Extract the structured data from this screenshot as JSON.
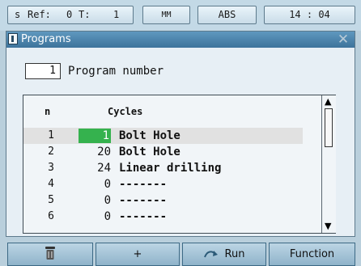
{
  "status_bar": {
    "mode": "s",
    "ref_label": "Ref:",
    "ref_value": "0",
    "t_label": "T:",
    "t_value": "1",
    "unit": "MM",
    "abs": "ABS",
    "clock": "14 : 04"
  },
  "window": {
    "title": "Programs",
    "program_number": "1",
    "program_number_label": "Program number"
  },
  "list": {
    "col_n": "n",
    "col_cycles": "Cycles",
    "rows": [
      {
        "n": "1",
        "cycle": "1",
        "name": "Bolt Hole"
      },
      {
        "n": "2",
        "cycle": "20",
        "name": "Bolt Hole"
      },
      {
        "n": "3",
        "cycle": "24",
        "name": "Linear drilling"
      },
      {
        "n": "4",
        "cycle": "0",
        "name": "-------"
      },
      {
        "n": "5",
        "cycle": "0",
        "name": "-------"
      },
      {
        "n": "6",
        "cycle": "0",
        "name": "-------"
      }
    ],
    "selected_row": 0
  },
  "softkeys": {
    "delete_icon": "trash-icon",
    "add": "+",
    "run_icon": "run-icon",
    "run": "Run",
    "function": "Function"
  },
  "colors": {
    "titlebar": "#4a83ab",
    "highlight": "#35b24e",
    "softkey": "#a9c8db"
  }
}
